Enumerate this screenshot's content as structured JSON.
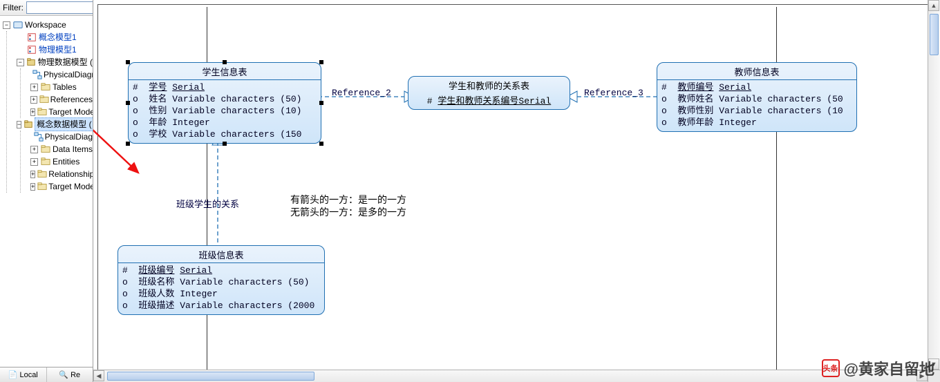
{
  "filter": {
    "label": "Filter:",
    "value": ""
  },
  "tree": {
    "root": "Workspace",
    "m1": "概念模型1",
    "m2": "物理模型1",
    "pdm": "物理数据模型 (",
    "pdm_children": {
      "diag": "PhysicalDiagr",
      "tables": "Tables",
      "refs": "References",
      "targets": "Target Models"
    },
    "cdm": "概念数据模型 (",
    "cdm_children": {
      "diag": "PhysicalDiag",
      "data": "Data Items",
      "ent": "Entities",
      "rel": "Relationships",
      "targets": "Target Models"
    }
  },
  "tabs": {
    "local": "Local",
    "repo": "Re"
  },
  "entities": {
    "student": {
      "title": "学生信息表",
      "rows": [
        {
          "mark": "#",
          "name": "学号",
          "type": "Serial",
          "pk": true
        },
        {
          "mark": "o",
          "name": "姓名",
          "type": "Variable characters (50)"
        },
        {
          "mark": "o",
          "name": "性别",
          "type": "Variable characters (10)"
        },
        {
          "mark": "o",
          "name": "年龄",
          "type": "Integer"
        },
        {
          "mark": "o",
          "name": "学校",
          "type": "Variable characters (150"
        }
      ]
    },
    "rel_st": {
      "title": "学生和教师的关系表",
      "row": {
        "mark": "#",
        "name": "学生和教师关系编号",
        "type": "Serial"
      }
    },
    "teacher": {
      "title": "教师信息表",
      "rows": [
        {
          "mark": "#",
          "name": "教师编号",
          "type": "Serial",
          "pk": true
        },
        {
          "mark": "o",
          "name": "教师姓名",
          "type": "Variable characters (50"
        },
        {
          "mark": "o",
          "name": "教师性别",
          "type": "Variable characters (10"
        },
        {
          "mark": "o",
          "name": "教师年龄",
          "type": "Integer"
        }
      ]
    },
    "class": {
      "title": "班级信息表",
      "rows": [
        {
          "mark": "#",
          "name": "班级编号",
          "type": "Serial",
          "pk": true
        },
        {
          "mark": "o",
          "name": "班级名称",
          "type": "Variable characters (50)"
        },
        {
          "mark": "o",
          "name": "班级人数",
          "type": "Integer"
        },
        {
          "mark": "o",
          "name": "班级描述",
          "type": "Variable characters (2000"
        }
      ]
    }
  },
  "links": {
    "ref2": "Reference_2",
    "ref3": "Reference_3",
    "class_rel": "班级学生的关系"
  },
  "notes": {
    "l1": "有箭头的一方：是一的一方",
    "l2": "无箭头的一方：是多的一方"
  },
  "watermark": {
    "logo": "头条",
    "text": "@黄家自留地"
  }
}
